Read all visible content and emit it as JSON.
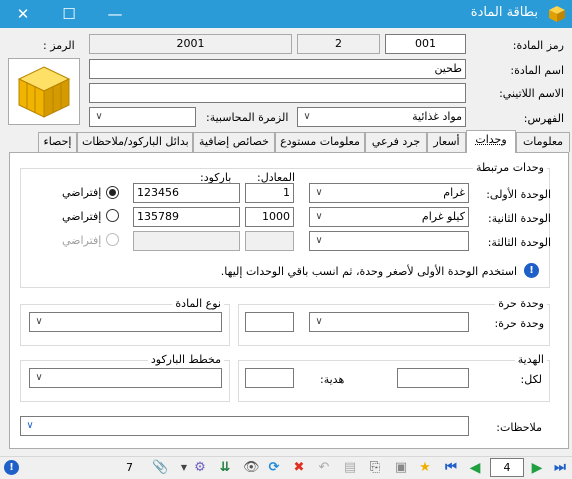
{
  "window": {
    "title": "بطاقة المادة"
  },
  "header": {
    "code_label": "رمز المادة:",
    "code_value": "001",
    "code_part2": "2",
    "code_part3": "2001",
    "symbol_label": "الرمز :",
    "name_label": "اسم المادة:",
    "name_value": "طحين",
    "latin_label": "الاسم اللاتيني:",
    "latin_value": "",
    "index_label": "الفهرس:",
    "index_value": "مواد غذائية",
    "acct_group_label": "الزمرة المحاسبية:",
    "acct_group_value": ""
  },
  "tabs": [
    "معلومات",
    "وحدات",
    "أسعار",
    "جرد فرعي",
    "معلومات مستودع",
    "خصائص إضافية",
    "بدائل الباركود/ملاحظات",
    "إحصاء"
  ],
  "units": {
    "group_title": "وحدات مرتبطة",
    "equiv_header": "المعادل:",
    "barcode_header": "باركود:",
    "rows": [
      {
        "label": "الوحدة الأولى:",
        "unit": "غرام",
        "equiv": "1",
        "barcode": "123456",
        "default_label": "إفتراضي"
      },
      {
        "label": "الوحدة الثانية:",
        "unit": "كيلو غرام",
        "equiv": "1000",
        "barcode": "135789",
        "default_label": "إفتراضي"
      },
      {
        "label": "الوحدة الثالثة:",
        "unit": "",
        "equiv": "",
        "barcode": "",
        "default_label": "إفتراضي"
      }
    ],
    "hint": "استخدم الوحدة الأولى لأصغر وحدة، ثم انسب باقي الوحدات إليها."
  },
  "free_unit": {
    "group_title": "وحدة حرة",
    "label": "وحدة حرة:"
  },
  "material_type": {
    "group_title": "نوع المادة"
  },
  "gift": {
    "group_title": "الهدية",
    "per_label": "لكل:",
    "gift_label": "هدية:"
  },
  "barcode_scheme": {
    "group_title": "مخطط الباركود"
  },
  "notes": {
    "label": "ملاحظات:"
  },
  "statusbar": {
    "attach_count": "7",
    "record_number": "4"
  }
}
